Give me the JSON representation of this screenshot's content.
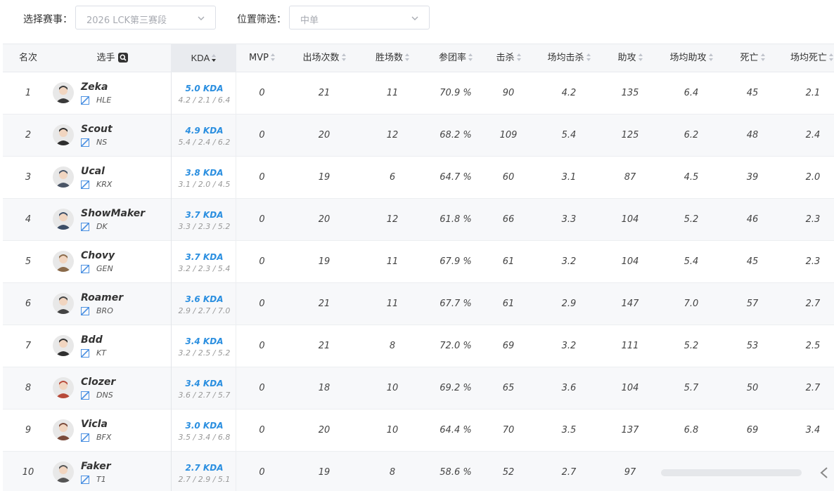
{
  "filters": {
    "event_label": "选择赛事：",
    "event_value": "2026 LCK第三赛段",
    "position_label": "位置筛选：",
    "position_value": "中单"
  },
  "columns": {
    "rank": "名次",
    "player": "选手",
    "kda": "KDA",
    "mvp": "MVP",
    "games": "出场次数",
    "wins": "胜场数",
    "kp": "参团率",
    "kills": "击杀",
    "avg_kills": "场均击杀",
    "assists": "助攻",
    "avg_assists": "场均助攻",
    "deaths": "死亡",
    "avg_deaths": "场均死亡"
  },
  "colors": {
    "kda_blue": "#2b8fe0",
    "team_flag": "#4a90e2"
  },
  "icons": {
    "search": "search-icon",
    "sort": "sort-icon",
    "chevron": "chevron-down-icon",
    "team": "team-logo-icon"
  },
  "rows": [
    {
      "rank": "1",
      "name": "Zeka",
      "team": "HLE",
      "kda": "5.0 KDA",
      "kda_detail": "4.2 / 2.1 / 6.4",
      "mvp": "0",
      "games": "21",
      "wins": "11",
      "kp": "70.9 %",
      "kills": "90",
      "avg_kills": "4.2",
      "assists": "135",
      "avg_assists": "6.4",
      "deaths": "45",
      "avg_deaths": "2.1"
    },
    {
      "rank": "2",
      "name": "Scout",
      "team": "NS",
      "kda": "4.9 KDA",
      "kda_detail": "5.4 / 2.4 / 6.2",
      "mvp": "0",
      "games": "20",
      "wins": "12",
      "kp": "68.2 %",
      "kills": "109",
      "avg_kills": "5.4",
      "assists": "125",
      "avg_assists": "6.2",
      "deaths": "48",
      "avg_deaths": "2.4"
    },
    {
      "rank": "3",
      "name": "Ucal",
      "team": "KRX",
      "kda": "3.8 KDA",
      "kda_detail": "3.1 / 2.0 / 4.5",
      "mvp": "0",
      "games": "19",
      "wins": "6",
      "kp": "64.7 %",
      "kills": "60",
      "avg_kills": "3.1",
      "assists": "87",
      "avg_assists": "4.5",
      "deaths": "39",
      "avg_deaths": "2.0"
    },
    {
      "rank": "4",
      "name": "ShowMaker",
      "team": "DK",
      "kda": "3.7 KDA",
      "kda_detail": "3.3 / 2.3 / 5.2",
      "mvp": "0",
      "games": "20",
      "wins": "12",
      "kp": "61.8 %",
      "kills": "66",
      "avg_kills": "3.3",
      "assists": "104",
      "avg_assists": "5.2",
      "deaths": "46",
      "avg_deaths": "2.3"
    },
    {
      "rank": "5",
      "name": "Chovy",
      "team": "GEN",
      "kda": "3.7 KDA",
      "kda_detail": "3.2 / 2.3 / 5.4",
      "mvp": "0",
      "games": "19",
      "wins": "11",
      "kp": "67.9 %",
      "kills": "61",
      "avg_kills": "3.2",
      "assists": "104",
      "avg_assists": "5.4",
      "deaths": "45",
      "avg_deaths": "2.3"
    },
    {
      "rank": "6",
      "name": "Roamer",
      "team": "BRO",
      "kda": "3.6 KDA",
      "kda_detail": "2.9 / 2.7 / 7.0",
      "mvp": "0",
      "games": "21",
      "wins": "11",
      "kp": "67.7 %",
      "kills": "61",
      "avg_kills": "2.9",
      "assists": "147",
      "avg_assists": "7.0",
      "deaths": "57",
      "avg_deaths": "2.7"
    },
    {
      "rank": "7",
      "name": "Bdd",
      "team": "KT",
      "kda": "3.4 KDA",
      "kda_detail": "3.2 / 2.5 / 5.2",
      "mvp": "0",
      "games": "21",
      "wins": "8",
      "kp": "72.0 %",
      "kills": "69",
      "avg_kills": "3.2",
      "assists": "111",
      "avg_assists": "5.2",
      "deaths": "53",
      "avg_deaths": "2.5"
    },
    {
      "rank": "8",
      "name": "Clozer",
      "team": "DNS",
      "kda": "3.4 KDA",
      "kda_detail": "3.6 / 2.7 / 5.7",
      "mvp": "0",
      "games": "18",
      "wins": "10",
      "kp": "69.2 %",
      "kills": "65",
      "avg_kills": "3.6",
      "assists": "104",
      "avg_assists": "5.7",
      "deaths": "50",
      "avg_deaths": "2.7"
    },
    {
      "rank": "9",
      "name": "Vicla",
      "team": "BFX",
      "kda": "3.0 KDA",
      "kda_detail": "3.5 / 3.4 / 6.8",
      "mvp": "0",
      "games": "20",
      "wins": "10",
      "kp": "64.4 %",
      "kills": "70",
      "avg_kills": "3.5",
      "assists": "137",
      "avg_assists": "6.8",
      "deaths": "69",
      "avg_deaths": "3.4"
    },
    {
      "rank": "10",
      "name": "Faker",
      "team": "T1",
      "kda": "2.7 KDA",
      "kda_detail": "2.7 / 2.9 / 5.1",
      "mvp": "0",
      "games": "19",
      "wins": "8",
      "kp": "58.6 %",
      "kills": "52",
      "avg_kills": "2.7",
      "assists": "97",
      "avg_assists": "",
      "deaths": "",
      "avg_deaths": ""
    }
  ]
}
